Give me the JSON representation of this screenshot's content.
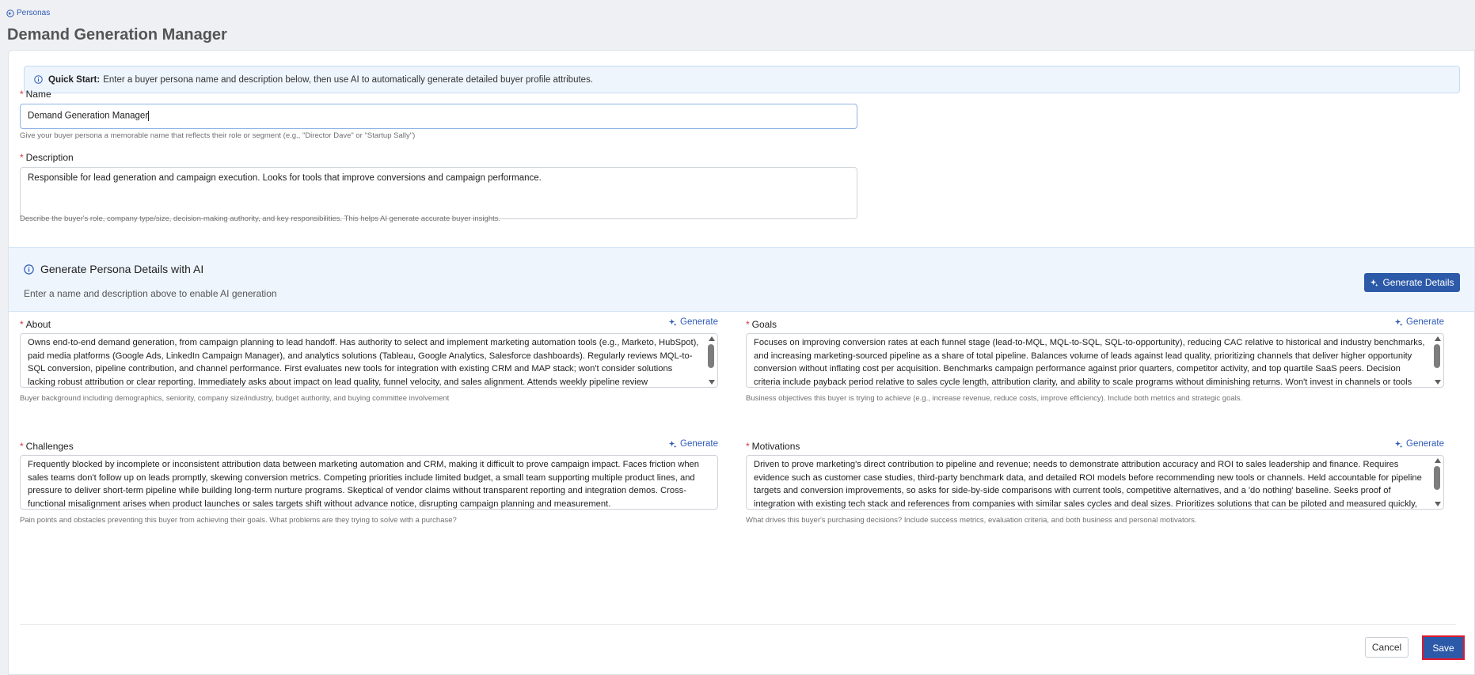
{
  "breadcrumb": {
    "back_label": "Personas"
  },
  "page": {
    "title": "Demand Generation Manager"
  },
  "quick_start": {
    "title": "Quick Start:",
    "text": "Enter a buyer persona name and description below, then use AI to automatically generate detailed buyer profile attributes."
  },
  "name_field": {
    "label": "Name",
    "value": "Demand Generation Manager",
    "hint": "Give your buyer persona a memorable name that reflects their role or segment (e.g., \"Director Dave\" or \"Startup Sally\")"
  },
  "description_field": {
    "label": "Description",
    "value": "Responsible for lead generation and campaign execution. Looks for tools that improve conversions and campaign performance.",
    "hint": "Describe the buyer's role, company type/size, decision-making authority, and key responsibilities. This helps AI generate accurate buyer insights."
  },
  "ai_section": {
    "title": "Generate Persona Details with AI",
    "subtitle": "Enter a name and description above to enable AI generation",
    "button_label": "Generate Details"
  },
  "sections": {
    "about": {
      "label": "About",
      "generate_label": "Generate",
      "value": "Owns end-to-end demand generation, from campaign planning to lead handoff. Has authority to select and implement marketing automation tools (e.g., Marketo, HubSpot), paid media platforms (Google Ads, LinkedIn Campaign Manager), and analytics solutions (Tableau, Google Analytics, Salesforce dashboards). Regularly reviews MQL-to-SQL conversion, pipeline contribution, and channel performance. First evaluates new tools for integration with existing CRM and MAP stack; won't consider solutions lacking robust attribution or clear reporting. Immediately asks about impact on lead quality, funnel velocity, and sales alignment. Attends weekly pipeline review",
      "hint": "Buyer background including demographics, seniority, company size/industry, budget authority, and buying committee involvement"
    },
    "goals": {
      "label": "Goals",
      "generate_label": "Generate",
      "value": "Focuses on improving conversion rates at each funnel stage (lead-to-MQL, MQL-to-SQL, SQL-to-opportunity), reducing CAC relative to historical and industry benchmarks, and increasing marketing-sourced pipeline as a share of total pipeline. Balances volume of leads against lead quality, prioritizing channels that deliver higher opportunity conversion without inflating cost per acquisition. Benchmarks campaign performance against prior quarters, competitor activity, and top quartile SaaS peers. Decision criteria include payback period relative to sales cycle length, attribution clarity, and ability to scale programs without diminishing returns. Won't invest in channels or tools",
      "hint": "Business objectives this buyer is trying to achieve (e.g., increase revenue, reduce costs, improve efficiency). Include both metrics and strategic goals."
    },
    "challenges": {
      "label": "Challenges",
      "generate_label": "Generate",
      "value": "Frequently blocked by incomplete or inconsistent attribution data between marketing automation and CRM, making it difficult to prove campaign impact. Faces friction when sales teams don't follow up on leads promptly, skewing conversion metrics. Competing priorities include limited budget, a small team supporting multiple product lines, and pressure to deliver short-term pipeline while building long-term nurture programs. Skeptical of vendor claims without transparent reporting and integration demos. Cross-functional misalignment arises when product launches or sales targets shift without advance notice, disrupting campaign planning and measurement.",
      "hint": "Pain points and obstacles preventing this buyer from achieving their goals. What problems are they trying to solve with a purchase?"
    },
    "motivations": {
      "label": "Motivations",
      "generate_label": "Generate",
      "value": "Driven to prove marketing's direct contribution to pipeline and revenue; needs to demonstrate attribution accuracy and ROI to sales leadership and finance. Requires evidence such as customer case studies, third-party benchmark data, and detailed ROI models before recommending new tools or channels. Held accountable for pipeline targets and conversion improvements, so asks for side-by-side comparisons with current tools, competitive alternatives, and a 'do nothing' baseline. Seeks proof of integration with existing tech stack and references from companies with similar sales cycles and deal sizes. Prioritizes solutions that can be piloted and measured quickly,",
      "hint": "What drives this buyer's purchasing decisions? Include success metrics, evaluation criteria, and both business and personal motivators."
    }
  },
  "footer": {
    "cancel_label": "Cancel",
    "save_label": "Save"
  },
  "colors": {
    "accent": "#2d5aa8",
    "link": "#2f5bb7",
    "required": "#d9363e",
    "info_bg": "#eef5fd",
    "highlight": "#e0192f"
  },
  "icons": [
    "back-arrow-icon",
    "info-icon",
    "sparkle-icon"
  ]
}
